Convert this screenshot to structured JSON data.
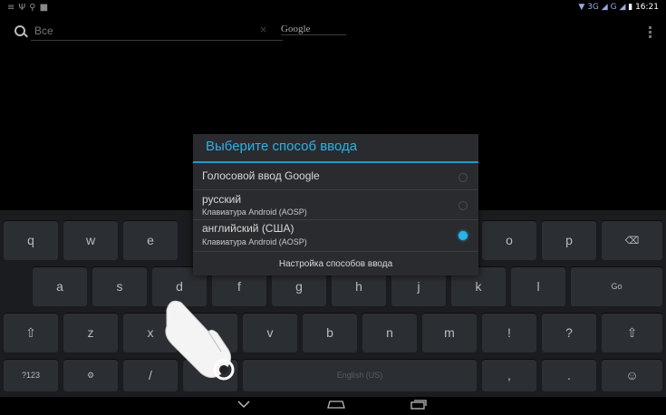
{
  "status_bar": {
    "left_icons": [
      "notification-icon",
      "usb-icon",
      "search-icon",
      "image-icon"
    ],
    "signal_text": "3G",
    "signal_text2": "G",
    "time": "16:21"
  },
  "search": {
    "placeholder": "Все",
    "engine_label": "Google"
  },
  "dialog": {
    "title": "Выберите способ ввода",
    "options": [
      {
        "label": "Голосовой ввод Google",
        "sub": "",
        "selected": false
      },
      {
        "label": "русский",
        "sub": "Клавиатура Android (AOSP)",
        "selected": false
      },
      {
        "label": "английский (США)",
        "sub": "Клавиатура Android (AOSP)",
        "selected": true
      }
    ],
    "settings_label": "Настройка способов ввода"
  },
  "keyboard": {
    "row1": [
      "q",
      "w",
      "e",
      "",
      "",
      "",
      "",
      "",
      "o",
      "p"
    ],
    "row2": [
      "a",
      "s",
      "d",
      "f",
      "g",
      "h",
      "j",
      "k",
      "l"
    ],
    "row3": [
      "z",
      "x",
      "c",
      "v",
      "b",
      "n",
      "m",
      "!",
      "?"
    ],
    "go_label": "Go",
    "symbols_label": "?123",
    "slash_label": "/",
    "comma_label": ",",
    "period_label": ".",
    "space_label": "English (US)",
    "shift_icon": "shift-icon",
    "backspace_icon": "backspace-icon",
    "emoji_icon": "smiley-icon",
    "settings_icon": "settings-key-icon",
    "mic_icon": "microphone-icon"
  },
  "nav_bar": {
    "icons": [
      "back-icon",
      "home-icon",
      "recent-apps-icon"
    ]
  },
  "colors": {
    "accent": "#2ab3e6",
    "dialog_bg": "#292b2f",
    "keyboard_bg": "#1a1c1f",
    "key_bg": "#2b2e32"
  }
}
